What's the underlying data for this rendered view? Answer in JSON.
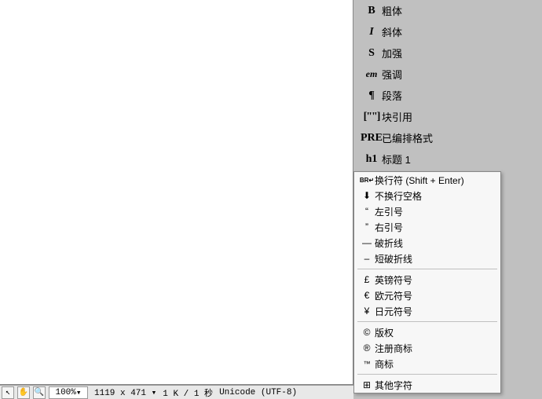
{
  "sidebar": {
    "items": [
      {
        "icon": "B",
        "label": "粗体"
      },
      {
        "icon": "I",
        "label": "斜体"
      },
      {
        "icon": "S",
        "label": "加强"
      },
      {
        "icon": "em",
        "label": "强调"
      },
      {
        "icon": "¶",
        "label": "段落"
      },
      {
        "icon": "[\"\"]",
        "label": "块引用"
      },
      {
        "icon": "PRE",
        "label": "已编排格式"
      },
      {
        "icon": "h1",
        "label": "标题 1"
      }
    ]
  },
  "popup": {
    "group1": [
      {
        "icon": "BR↵",
        "label": "换行符 (Shift + Enter)"
      },
      {
        "icon": "⬇",
        "label": "不换行空格"
      },
      {
        "icon": "“",
        "label": "左引号"
      },
      {
        "icon": "”",
        "label": "右引号"
      },
      {
        "icon": "—",
        "label": "破折线"
      },
      {
        "icon": "–",
        "label": "短破折线"
      }
    ],
    "group2": [
      {
        "icon": "£",
        "label": "英镑符号"
      },
      {
        "icon": "€",
        "label": "欧元符号"
      },
      {
        "icon": "¥",
        "label": "日元符号"
      }
    ],
    "group3": [
      {
        "icon": "©",
        "label": "版权"
      },
      {
        "icon": "®",
        "label": "注册商标"
      },
      {
        "icon": "™",
        "label": "商标"
      }
    ],
    "group4": [
      {
        "icon": "⊞",
        "label": "其他字符"
      }
    ]
  },
  "statusbar": {
    "zoom": "100%",
    "dims": "1119 x 471",
    "size": "1 K / 1 秒",
    "encoding": "Unicode (UTF-8)"
  }
}
